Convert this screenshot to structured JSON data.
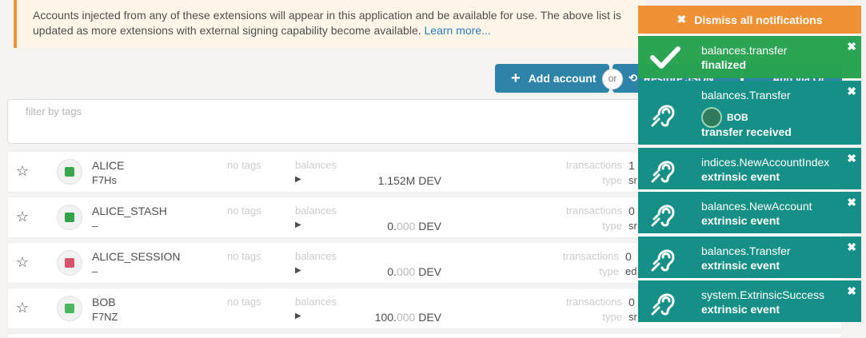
{
  "banner": {
    "text": "Accounts injected from any of these extensions will appear in this application and be available for use. The above list is updated as more extensions with external signing capability become available.",
    "link": "Learn more..."
  },
  "toolbar": {
    "add_account": "Add account",
    "or": "or",
    "restore_json": "Restore JSON",
    "add_via_qr": "Add via Qr"
  },
  "filter": {
    "placeholder": "filter by tags"
  },
  "labels": {
    "no_tags": "no tags",
    "balances": "balances",
    "transactions": "transactions",
    "type": "type"
  },
  "accounts": [
    {
      "name": "ALICE",
      "short": "F7Hs",
      "balance_int": "1.152M",
      "balance_dec": "",
      "unit": "DEV",
      "transactions": "1",
      "type": "sr",
      "avatar_color": "#3aa84a"
    },
    {
      "name": "ALICE_STASH",
      "short": "–",
      "balance_int": "0.",
      "balance_dec": "000",
      "unit": "DEV",
      "transactions": "0",
      "type": "sr",
      "avatar_color": "#32a34a"
    },
    {
      "name": "ALICE_SESSION",
      "short": "–",
      "balance_int": "0.",
      "balance_dec": "000",
      "unit": "DEV",
      "transactions": "0",
      "type": "ed",
      "avatar_color": "#d9546a"
    },
    {
      "name": "BOB",
      "short": "F7NZ",
      "balance_int": "100.",
      "balance_dec": "000",
      "unit": "DEV",
      "transactions": "0",
      "type": "sr",
      "avatar_color": "#4cb75c"
    }
  ],
  "notifications": {
    "dismiss_all": "Dismiss all notifications",
    "items": [
      {
        "title": "balances.transfer",
        "subtitle": "finalized",
        "icon": "checkmark-icon",
        "status_color": "#26a24f"
      },
      {
        "title": "balances.Transfer",
        "account": "BOB",
        "subtitle": "transfer received",
        "icon": "hearing-icon",
        "status_color": "#168f87"
      },
      {
        "title": "indices.NewAccountIndex",
        "subtitle": "extrinsic event",
        "icon": "hearing-icon",
        "status_color": "#168f87"
      },
      {
        "title": "balances.NewAccount",
        "subtitle": "extrinsic event",
        "icon": "hearing-icon",
        "status_color": "#168f87"
      },
      {
        "title": "balances.Transfer",
        "subtitle": "extrinsic event",
        "icon": "hearing-icon",
        "status_color": "#168f87"
      },
      {
        "title": "system.ExtrinsicSuccess",
        "subtitle": "extrinsic event",
        "icon": "hearing-icon",
        "status_color": "#168f87"
      }
    ]
  }
}
